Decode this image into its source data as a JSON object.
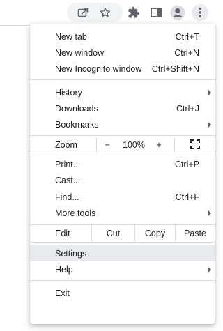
{
  "toolbar": {
    "icons": [
      "share-icon",
      "star-icon",
      "extensions-icon",
      "side-panel-icon",
      "profile-icon",
      "more-menu-icon"
    ]
  },
  "menu": {
    "new_tab": {
      "label": "New tab",
      "shortcut": "Ctrl+T"
    },
    "new_window": {
      "label": "New window",
      "shortcut": "Ctrl+N"
    },
    "new_incognito": {
      "label": "New Incognito window",
      "shortcut": "Ctrl+Shift+N"
    },
    "history": {
      "label": "History"
    },
    "downloads": {
      "label": "Downloads",
      "shortcut": "Ctrl+J"
    },
    "bookmarks": {
      "label": "Bookmarks"
    },
    "zoom": {
      "label": "Zoom",
      "minus": "−",
      "value": "100%",
      "plus": "+"
    },
    "print": {
      "label": "Print...",
      "shortcut": "Ctrl+P"
    },
    "cast": {
      "label": "Cast..."
    },
    "find": {
      "label": "Find...",
      "shortcut": "Ctrl+F"
    },
    "more_tools": {
      "label": "More tools"
    },
    "edit": {
      "label": "Edit",
      "cut": "Cut",
      "copy": "Copy",
      "paste": "Paste"
    },
    "settings": {
      "label": "Settings"
    },
    "help": {
      "label": "Help"
    },
    "exit": {
      "label": "Exit"
    }
  },
  "colors": {
    "highlight": "#e8eaed",
    "separator": "#dadce0",
    "icon": "#5f6368",
    "text": "#202124"
  }
}
